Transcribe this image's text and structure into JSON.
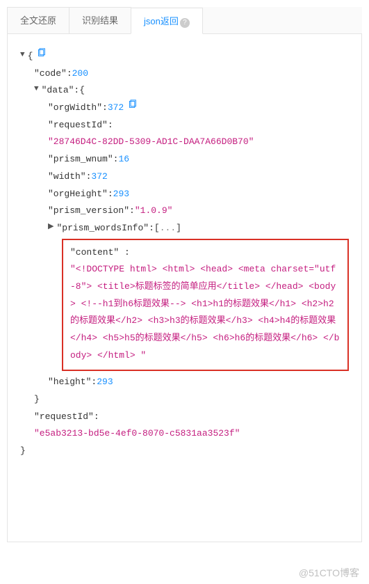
{
  "tabs": {
    "t0": "全文还原",
    "t1": "识别结果",
    "t2": "json返回"
  },
  "json": {
    "code_key": "\"code\"",
    "code_val": "200",
    "data_key": "\"data\"",
    "orgWidth_key": "\"orgWidth\"",
    "orgWidth_val": "372",
    "requestId_key": "\"requestId\"",
    "requestId_val": "\"28746D4C-82DD-5309-AD1C-DAA7A66D0B70\"",
    "prism_wnum_key": "\"prism_wnum\"",
    "prism_wnum_val": "16",
    "width_key": "\"width\"",
    "width_val": "372",
    "orgHeight_key": "\"orgHeight\"",
    "orgHeight_val": "293",
    "prism_version_key": "\"prism_version\"",
    "prism_version_val": "\"1.0.9\"",
    "prism_wordsInfo_key": "\"prism_wordsInfo\"",
    "ellipsis": "...",
    "content_key": "\"content\"",
    "content_val": "\"<!DOCTYPE html> <html> <head> <meta charset=\"utf-8\"> <title>标题标签的简单应用</title> </head> <body> <!--h1到h6标题效果--> <h1>h1的标题效果</h1> <h2>h2的标题效果</h2> <h3>h3的标题效果</h3> <h4>h4的标题效果</h4> <h5>h5的标题效果</h5> <h6>h6的标题效果</h6> </body> </html> \"",
    "height_key": "\"height\"",
    "height_val": "293",
    "requestId2_key": "\"requestId\"",
    "requestId2_val": "\"e5ab3213-bd5e-4ef0-8070-c5831aa3523f\""
  },
  "footer": "@51CTO博客"
}
